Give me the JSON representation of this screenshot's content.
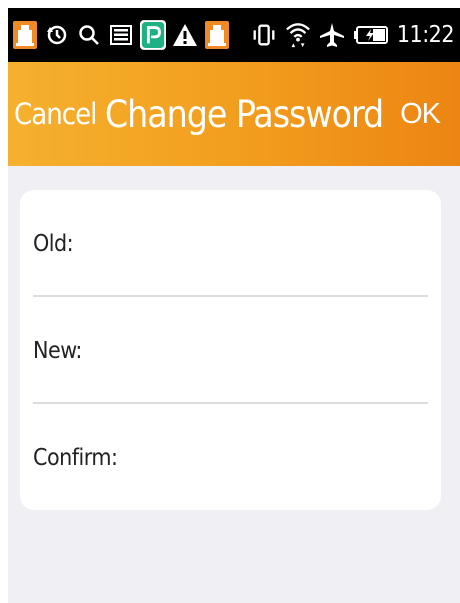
{
  "status_bar": {
    "time": "11:22",
    "left_icons": [
      "alarm-app-icon",
      "sync-icon",
      "search-icon",
      "screenshot-icon",
      "parking-app-icon",
      "warning-icon",
      "alarm-app-icon"
    ],
    "right_icons": [
      "vibrate-icon",
      "wifi-icon",
      "airplane-icon",
      "battery-charging-icon"
    ]
  },
  "nav": {
    "cancel_label": "Cancel",
    "title": "Change Password",
    "ok_label": "OK"
  },
  "form": {
    "old_label": "Old:",
    "new_label": "New:",
    "confirm_label": "Confirm:",
    "old_value": "",
    "new_value": "",
    "confirm_value": ""
  },
  "colors": {
    "nav_gradient_start": "#f5b12e",
    "nav_gradient_end": "#ec8513",
    "content_bg": "#efeff4",
    "card_bg": "#ffffff",
    "divider": "#dcdcdc",
    "status_bg": "#000000"
  }
}
